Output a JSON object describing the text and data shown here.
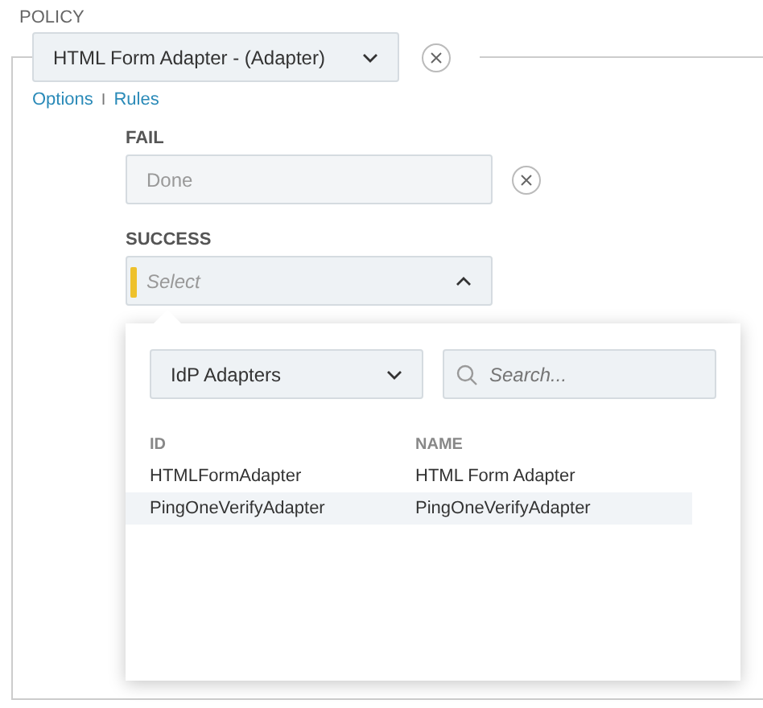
{
  "section_label": "POLICY",
  "policy_select": {
    "value": "HTML Form Adapter - (Adapter)"
  },
  "links": [
    "Options",
    "Rules"
  ],
  "link_separator": "I",
  "fail": {
    "label": "FAIL",
    "value": "Done"
  },
  "success": {
    "label": "SUCCESS",
    "placeholder": "Select",
    "expanded": true
  },
  "popup": {
    "filter_select": {
      "value": "IdP Adapters"
    },
    "search": {
      "placeholder": "Search..."
    },
    "columns": [
      "ID",
      "NAME"
    ],
    "rows": [
      {
        "id": "HTMLFormAdapter",
        "name": "HTML Form Adapter",
        "selected": false
      },
      {
        "id": "PingOneVerifyAdapter",
        "name": "PingOneVerifyAdapter",
        "selected": true
      }
    ]
  }
}
